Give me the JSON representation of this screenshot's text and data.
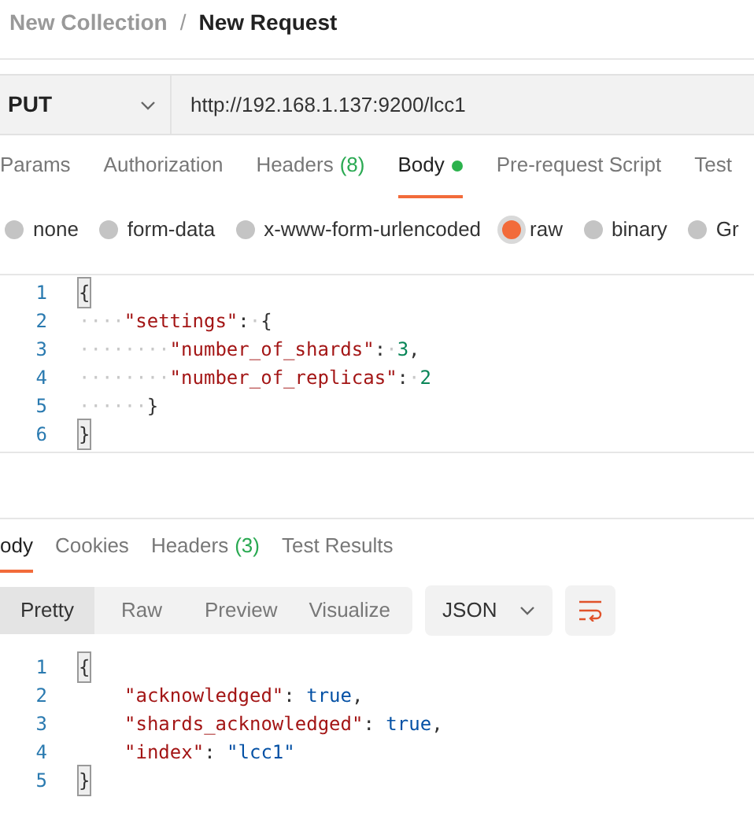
{
  "breadcrumb": {
    "collection": "New Collection",
    "separator": "/",
    "request": "New Request"
  },
  "request": {
    "method": "PUT",
    "url": "http://192.168.1.137:9200/lcc1"
  },
  "request_tabs": [
    {
      "label": "Params",
      "selected": false
    },
    {
      "label": "Authorization",
      "selected": false
    },
    {
      "label": "Headers",
      "count": "(8)",
      "selected": false
    },
    {
      "label": "Body",
      "selected": true,
      "dot": true
    },
    {
      "label": "Pre-request Script",
      "selected": false
    },
    {
      "label": "Test",
      "selected": false
    }
  ],
  "body_types": [
    {
      "label": "none",
      "selected": false
    },
    {
      "label": "form-data",
      "selected": false
    },
    {
      "label": "x-www-form-urlencoded",
      "selected": false
    },
    {
      "label": "raw",
      "selected": true
    },
    {
      "label": "binary",
      "selected": false
    },
    {
      "label": "Gr",
      "selected": false
    }
  ],
  "request_body": [
    {
      "number": "1",
      "tokens": [
        {
          "kind": "brace",
          "text": "{"
        }
      ]
    },
    {
      "number": "2",
      "tokens": [
        {
          "kind": "ws",
          "text": "····"
        },
        {
          "kind": "key",
          "text": "\"settings\""
        },
        {
          "kind": "punct",
          "text": ":"
        },
        {
          "kind": "ws",
          "text": "·"
        },
        {
          "kind": "punct",
          "text": "{"
        }
      ]
    },
    {
      "number": "3",
      "tokens": [
        {
          "kind": "ws",
          "text": "········"
        },
        {
          "kind": "key",
          "text": "\"number_of_shards\""
        },
        {
          "kind": "punct",
          "text": ":"
        },
        {
          "kind": "ws",
          "text": "·"
        },
        {
          "kind": "number",
          "text": "3"
        },
        {
          "kind": "punct",
          "text": ","
        }
      ]
    },
    {
      "number": "4",
      "tokens": [
        {
          "kind": "ws",
          "text": "········"
        },
        {
          "kind": "key",
          "text": "\"number_of_replicas\""
        },
        {
          "kind": "punct",
          "text": ":"
        },
        {
          "kind": "ws",
          "text": "·"
        },
        {
          "kind": "number",
          "text": "2"
        }
      ]
    },
    {
      "number": "5",
      "tokens": [
        {
          "kind": "ws",
          "text": "······"
        },
        {
          "kind": "punct",
          "text": "}"
        }
      ]
    },
    {
      "number": "6",
      "tokens": [
        {
          "kind": "brace",
          "text": "}"
        }
      ]
    }
  ],
  "response_tabs": [
    {
      "label": "ody",
      "selected": true
    },
    {
      "label": "Cookies",
      "selected": false
    },
    {
      "label": "Headers",
      "count": "(3)",
      "selected": false
    },
    {
      "label": "Test Results",
      "selected": false
    }
  ],
  "view_modes": [
    {
      "label": "Pretty",
      "selected": true
    },
    {
      "label": "Raw",
      "selected": false
    },
    {
      "label": "Preview",
      "selected": false
    },
    {
      "label": "Visualize",
      "selected": false
    }
  ],
  "format": "JSON",
  "response_body": [
    {
      "number": "1",
      "indented": false,
      "tokens": [
        {
          "kind": "brace",
          "text": "{"
        }
      ]
    },
    {
      "number": "2",
      "indented": true,
      "tokens": [
        {
          "kind": "key",
          "text": "\"acknowledged\""
        },
        {
          "kind": "punct",
          "text": ": "
        },
        {
          "kind": "bool",
          "text": "true"
        },
        {
          "kind": "punct",
          "text": ","
        }
      ]
    },
    {
      "number": "3",
      "indented": true,
      "tokens": [
        {
          "kind": "key",
          "text": "\"shards_acknowledged\""
        },
        {
          "kind": "punct",
          "text": ": "
        },
        {
          "kind": "bool",
          "text": "true"
        },
        {
          "kind": "punct",
          "text": ","
        }
      ]
    },
    {
      "number": "4",
      "indented": true,
      "tokens": [
        {
          "kind": "key",
          "text": "\"index\""
        },
        {
          "kind": "punct",
          "text": ": "
        },
        {
          "kind": "string",
          "text": "\"lcc1\""
        }
      ]
    },
    {
      "number": "5",
      "indented": false,
      "tokens": [
        {
          "kind": "brace",
          "text": "}"
        }
      ]
    }
  ]
}
